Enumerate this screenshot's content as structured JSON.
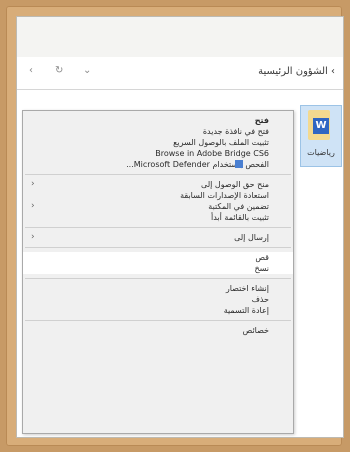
{
  "address_bar": {
    "breadcrumb": "› الشؤون الرئيسية",
    "ctrl_back": "‹",
    "ctrl_refresh": "↻",
    "ctrl_dropdown": "⌄"
  },
  "file": {
    "name": "رياضيات",
    "icon": "word-document-icon",
    "badge": "W"
  },
  "context_menu": {
    "groups": [
      [
        {
          "label": "فتح",
          "bold": true,
          "sub": false
        },
        {
          "label": "فتح في نافذة جديدة",
          "bold": false,
          "sub": false
        },
        {
          "label": "تثبيت الملف بالوصول السريع",
          "bold": false,
          "sub": false
        },
        {
          "label": "Browse in Adobe Bridge CS6",
          "bold": false,
          "sub": false
        },
        {
          "label": "الفحص باستخدام Microsoft Defender...",
          "bold": false,
          "sub": false,
          "icon": "defender-icon"
        }
      ],
      [
        {
          "label": "منح حق الوصول إلى",
          "bold": false,
          "sub": true
        },
        {
          "label": "استعادة الإصدارات السابقة",
          "bold": false,
          "sub": false
        },
        {
          "label": "تضمين في المكتبة",
          "bold": false,
          "sub": true
        },
        {
          "label": "تثبيت بالقائمة أبدأ",
          "bold": false,
          "sub": false
        }
      ],
      [
        {
          "label": "إرسال إلى",
          "bold": false,
          "sub": true
        }
      ],
      [
        {
          "label": "قص",
          "bold": false,
          "sub": false
        },
        {
          "label": "نسخ",
          "bold": false,
          "sub": false
        }
      ],
      [
        {
          "label": "إنشاء اختصار",
          "bold": false,
          "sub": false
        },
        {
          "label": "حذف",
          "bold": false,
          "sub": false
        },
        {
          "label": "إعادة التسمية",
          "bold": false,
          "sub": false
        }
      ],
      [
        {
          "label": "خصائص",
          "bold": false,
          "sub": false
        }
      ]
    ]
  }
}
